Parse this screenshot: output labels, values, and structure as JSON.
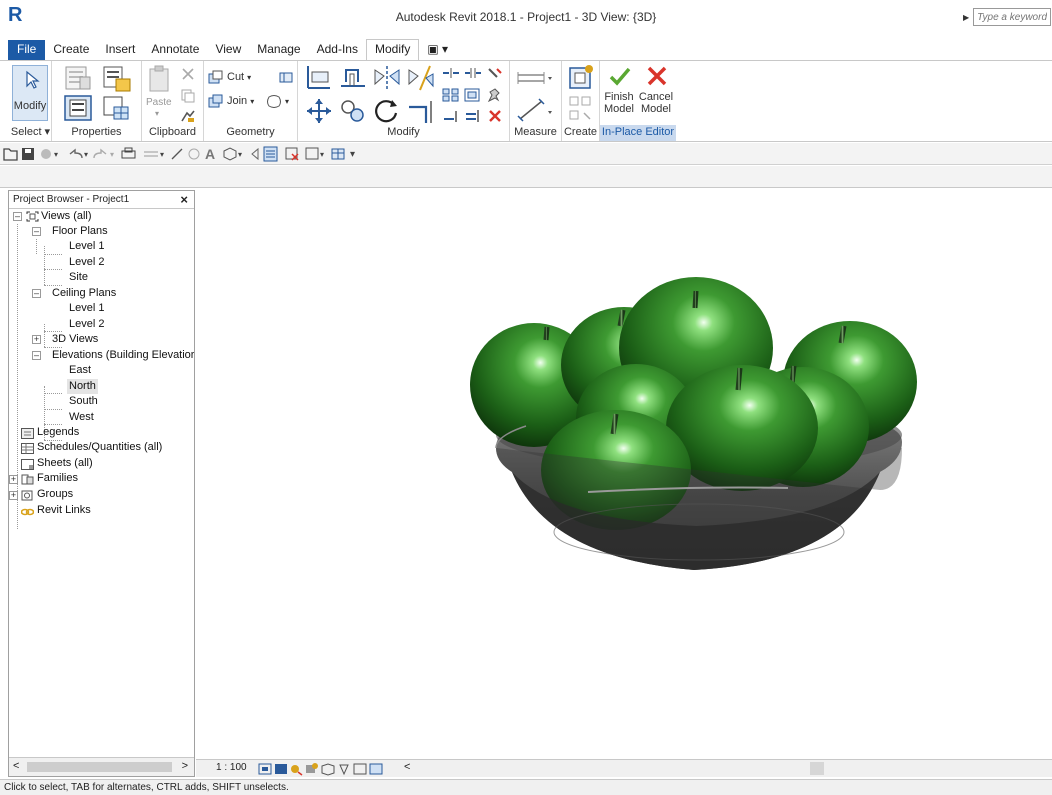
{
  "app": {
    "logo": "R",
    "title": "Autodesk Revit 2018.1 -    Project1 - 3D View: {3D}",
    "search_placeholder": "Type a keyword or phrase"
  },
  "tabs": [
    {
      "label": "File"
    },
    {
      "label": "Create"
    },
    {
      "label": "Insert"
    },
    {
      "label": "Annotate"
    },
    {
      "label": "View"
    },
    {
      "label": "Manage"
    },
    {
      "label": "Add-Ins"
    },
    {
      "label": "Modify"
    },
    {
      "label": "▣ ▾"
    }
  ],
  "ribbon": {
    "modify_label": "Modify",
    "paste_label": "Paste",
    "cut_label": "Cut",
    "join_label": "Join",
    "finish_label": "Finish Model",
    "cancel_label": "Cancel Model",
    "panels": {
      "select": "Select ▾",
      "properties": "Properties",
      "clipboard": "Clipboard",
      "geometry": "Geometry",
      "modify": "Modify",
      "measure": "Measure",
      "create": "Create",
      "inplace": "In-Place Editor"
    },
    "colors": {
      "finish": "#5aa832",
      "cancel": "#d9342b",
      "inplace_bg": "#c9d9ee"
    }
  },
  "browser": {
    "title": "Project Browser - Project1",
    "close": "×",
    "nodes": [
      {
        "label": "Views (all)",
        "icon": "views-icon"
      },
      {
        "label": "Floor Plans"
      },
      {
        "label": "Level 1"
      },
      {
        "label": "Level 2"
      },
      {
        "label": "Site"
      },
      {
        "label": "Ceiling Plans"
      },
      {
        "label": "Level 1"
      },
      {
        "label": "Level 2"
      },
      {
        "label": "3D Views"
      },
      {
        "label": "Elevations (Building Elevatior"
      },
      {
        "label": "East"
      },
      {
        "label": "North",
        "selected": true
      },
      {
        "label": "South"
      },
      {
        "label": "West"
      },
      {
        "label": "Legends",
        "icon": "legends-icon"
      },
      {
        "label": "Schedules/Quantities (all)",
        "icon": "schedules-icon"
      },
      {
        "label": "Sheets (all)",
        "icon": "sheets-icon"
      },
      {
        "label": "Families",
        "icon": "families-icon"
      },
      {
        "label": "Groups",
        "icon": "groups-icon"
      },
      {
        "label": "Revit Links",
        "icon": "revit-links-icon"
      }
    ],
    "scroll_left": "<",
    "scroll_right": ">"
  },
  "viewbar": {
    "scale": "1 : 100",
    "collapse": "<"
  },
  "status": "Click to select, TAB for alternates, CTRL adds, SHIFT unselects."
}
